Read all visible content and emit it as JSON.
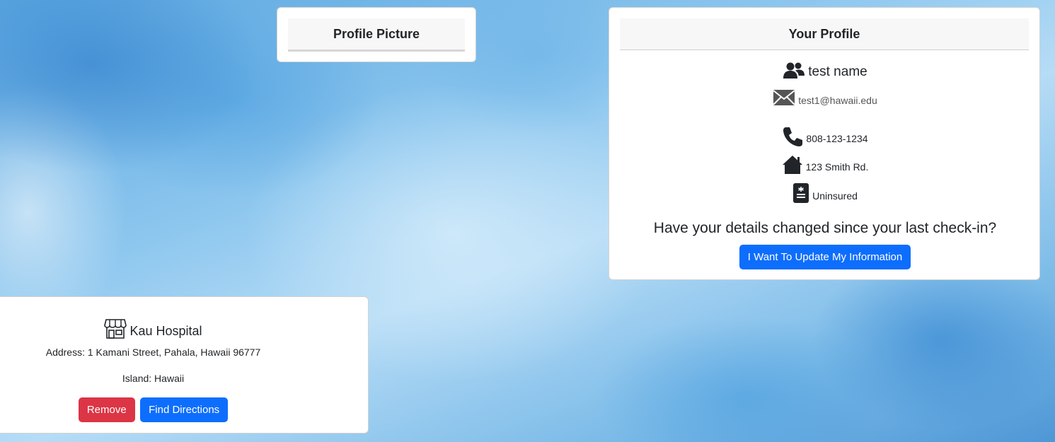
{
  "profile_picture": {
    "title": "Profile Picture"
  },
  "your_profile": {
    "title": "Your Profile",
    "name": "test name",
    "email": "test1@hawaii.edu",
    "phone": "808-123-1234",
    "address": "123 Smith Rd.",
    "insurance": "Uninsured",
    "question": "Have your details changed since your last check-in?",
    "update_button": "I Want To Update My Information",
    "icons": [
      "users-icon",
      "envelope-icon",
      "phone-icon",
      "house-icon",
      "insurance-card-icon"
    ]
  },
  "hospital": {
    "name": "Kau Hospital",
    "address": "Address: 1 Kamani Street, Pahala, Hawaii 96777",
    "island": "Island: Hawaii",
    "remove_button": "Remove",
    "directions_button": "Find Directions",
    "icon": "shop-icon"
  },
  "colors": {
    "primary": "#0d6efd",
    "danger": "#dc3545",
    "header_bg": "#f7f7f7"
  }
}
